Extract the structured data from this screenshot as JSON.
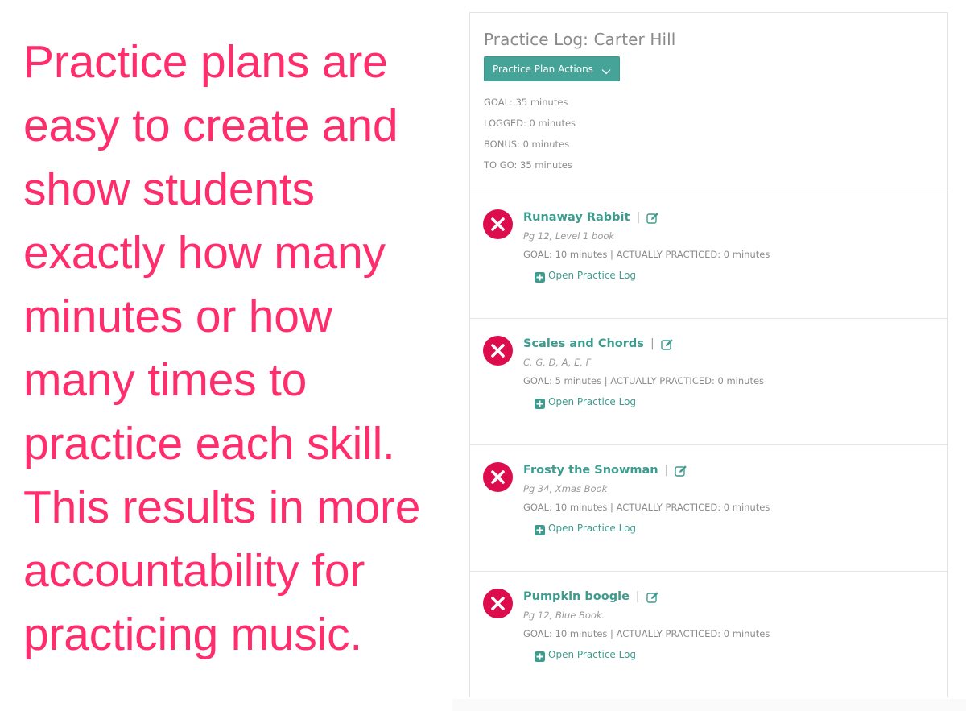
{
  "promo": {
    "lines": [
      "Practice plans are",
      "easy to create and",
      "show students",
      "exactly how many",
      "minutes or how",
      "many times to",
      "practice each skill.",
      "This results in more",
      "accountability for",
      "practicing music."
    ],
    "color": "#ff2d6b"
  },
  "panel": {
    "title": "Practice Log: Carter Hill",
    "actions_button": {
      "label": "Practice Plan Actions",
      "icon": "chevron-down-icon"
    },
    "stats": {
      "goal": "GOAL: 35 minutes",
      "logged": "LOGGED: 0 minutes",
      "bonus": "BONUS: 0 minutes",
      "to_go": "TO GO: 35 minutes"
    },
    "items": [
      {
        "title": "Runaway Rabbit",
        "separator": "|",
        "note": "Pg 12, Level 1 book",
        "goal_line": "GOAL: 10 minutes | ACTUALLY PRACTICED: 0 minutes",
        "open_log_label": "Open Practice Log",
        "status_icon": "x-circle-icon"
      },
      {
        "title": "Scales and Chords",
        "separator": "|",
        "note": "C, G, D, A, E, F",
        "goal_line": "GOAL: 5 minutes | ACTUALLY PRACTICED: 0 minutes",
        "open_log_label": "Open Practice Log",
        "status_icon": "x-circle-icon"
      },
      {
        "title": "Frosty the Snowman",
        "separator": "|",
        "note": "Pg 34, Xmas Book",
        "goal_line": "GOAL: 10 minutes | ACTUALLY PRACTICED: 0 minutes",
        "open_log_label": "Open Practice Log",
        "status_icon": "x-circle-icon"
      },
      {
        "title": "Pumpkin boogie",
        "separator": "|",
        "note": "Pg 12, Blue Book.",
        "goal_line": "GOAL: 10 minutes | ACTUALLY PRACTICED: 0 minutes",
        "open_log_label": "Open Practice Log",
        "status_icon": "x-circle-icon"
      }
    ],
    "colors": {
      "accent": "#45a497",
      "link": "#3e9c8f",
      "status_incomplete": "#dd0d4d"
    }
  }
}
